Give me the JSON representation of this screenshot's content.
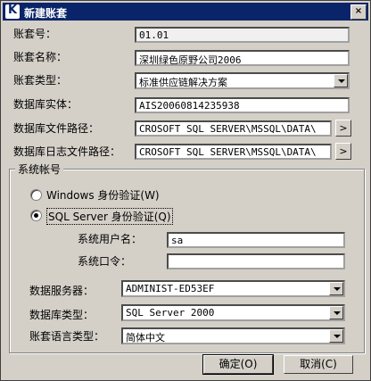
{
  "window": {
    "title": "新建账套",
    "close_label": "×"
  },
  "fields": {
    "account_no": {
      "label": "账套号：",
      "value": "01.01"
    },
    "account_name": {
      "label": "账套名称：",
      "value": "深圳绿色原野公司2006"
    },
    "account_type": {
      "label": "账套类型：",
      "value": "标准供应链解决方案"
    },
    "db_instance": {
      "label": "数据库实体：",
      "value": "AIS20060814235938"
    },
    "db_file_path": {
      "label": "数据库文件路径：",
      "value": "CROSOFT SQL SERVER\\MSSQL\\DATA\\"
    },
    "db_log_path": {
      "label": "数据库日志文件路径：",
      "value": "CROSOFT SQL SERVER\\MSSQL\\DATA\\"
    },
    "browse_label": ">"
  },
  "system_account": {
    "group_title": "系统帐号",
    "windows_auth": "Windows 身份验证(W)",
    "sql_auth": "SQL Server 身份验证(Q)",
    "user_label": "系统用户名：",
    "user_value": "sa",
    "password_label": "系统口令：",
    "password_value": "",
    "db_server_label": "数据服务器：",
    "db_server_value": "ADMINIST-ED53EF",
    "db_type_label": "数据库类型：",
    "db_type_value": "SQL Server 2000",
    "lang_label": "账套语言类型：",
    "lang_value": "简体中文"
  },
  "buttons": {
    "ok": "确定(O)",
    "cancel": "取消(C)"
  }
}
